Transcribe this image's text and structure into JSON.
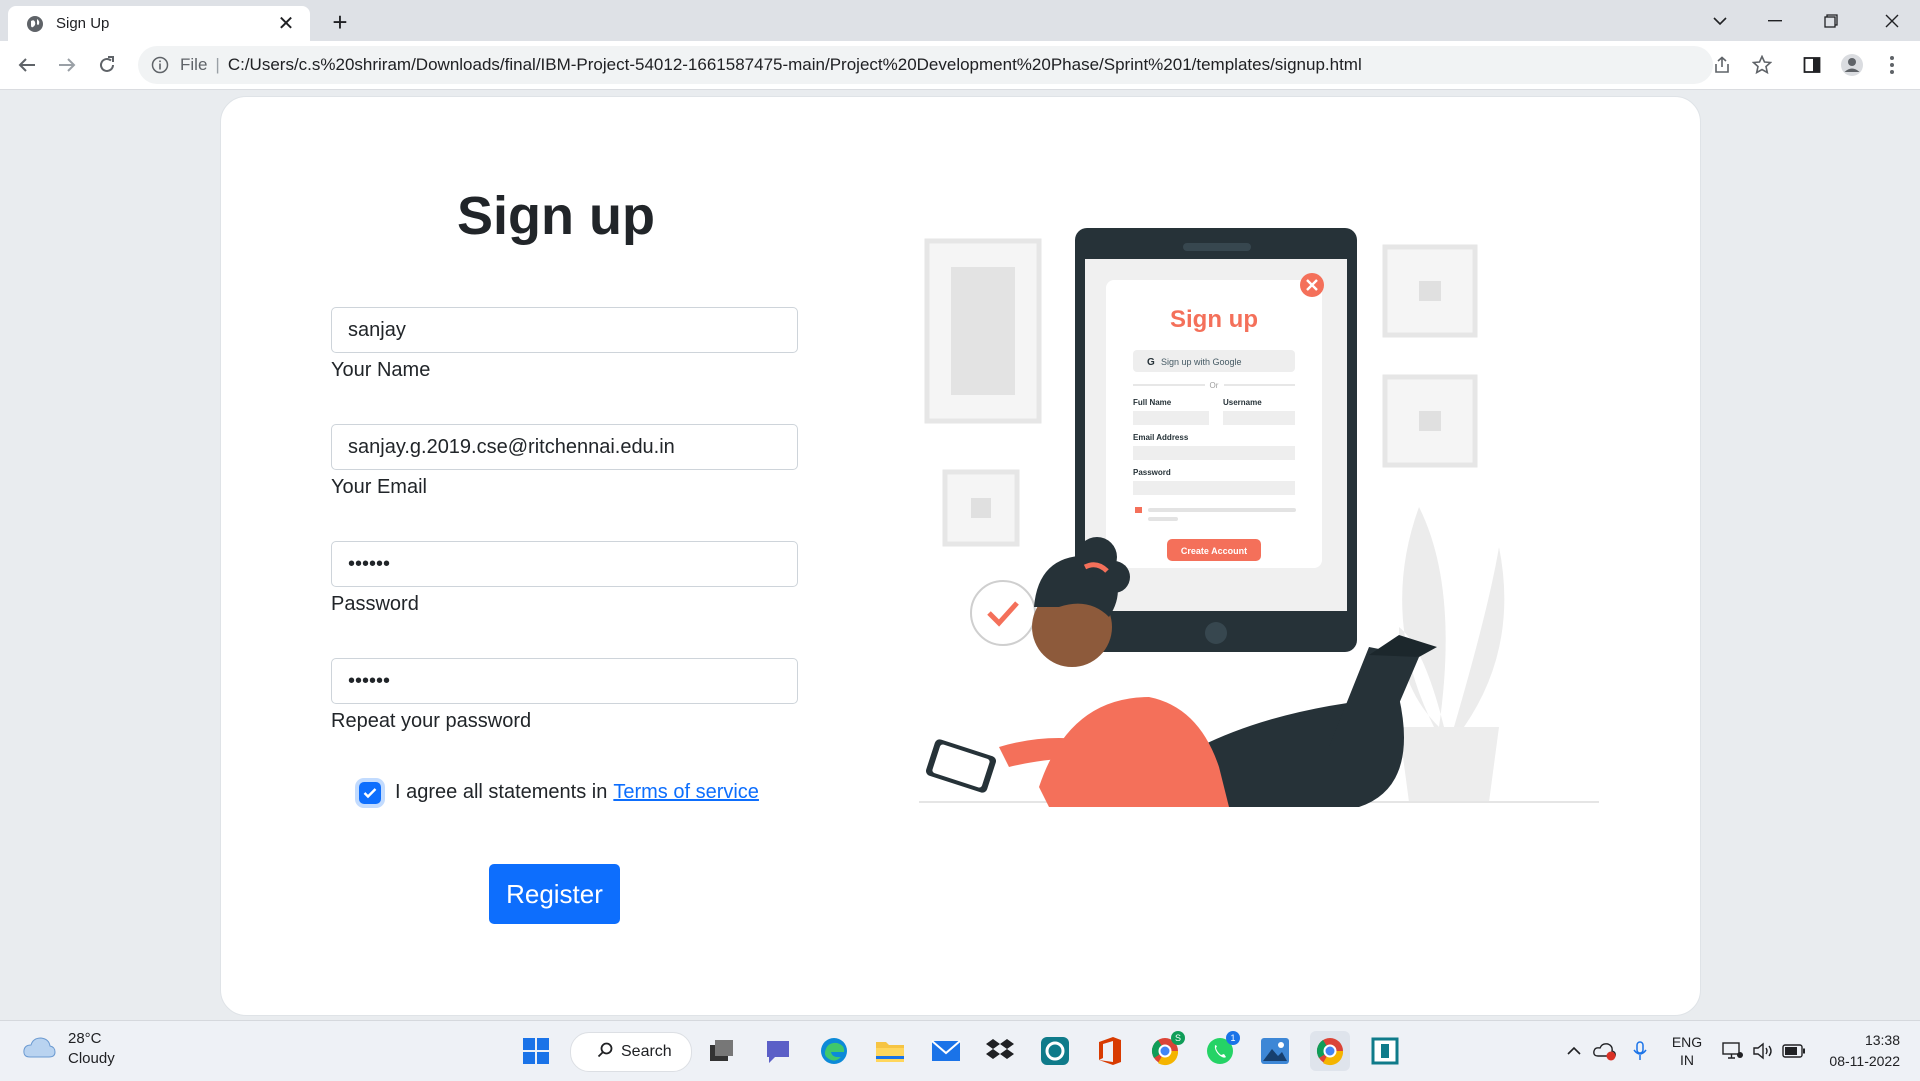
{
  "browser": {
    "tab_title": "Sign Up",
    "scheme_label": "File",
    "url": "C:/Users/c.s%20shriram/Downloads/final/IBM-Project-54012-1661587475-main/Project%20Development%20Phase/Sprint%201/templates/signup.html"
  },
  "page": {
    "heading": "Sign up",
    "fields": [
      {
        "value": "sanjay",
        "label": "Your Name"
      },
      {
        "value": "sanjay.g.2019.cse@ritchennai.edu.in",
        "label": "Your Email"
      },
      {
        "value": "••••••",
        "label": "Password"
      },
      {
        "value": "••••••",
        "label": "Repeat your password"
      }
    ],
    "agree_text": "I agree all statements in",
    "terms_link": "Terms of service",
    "agree_checked": true,
    "register_label": "Register",
    "accent_color": "#0d6efd"
  },
  "illustration": {
    "form_title": "Sign up",
    "google_button": "Sign up with Google",
    "or_text": "Or",
    "full_name_label": "Full Name",
    "username_label": "Username",
    "email_label": "Email Address",
    "password_label": "Password",
    "create_account_button": "Create Account",
    "accent_color": "#f4705a"
  },
  "taskbar": {
    "weather_temp": "28°C",
    "weather_desc": "Cloudy",
    "search_label": "Search",
    "lang_line1": "ENG",
    "lang_line2": "IN",
    "time": "13:38",
    "date": "08-11-2022",
    "chrome_badge": "S",
    "whatsapp_badge": "1"
  }
}
